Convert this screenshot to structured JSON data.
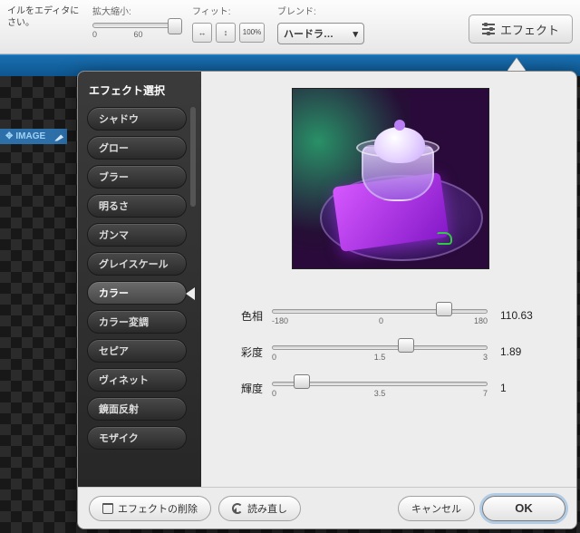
{
  "topbar": {
    "hint": "イルをエディタにさい。",
    "zoom_label": "拡大縮小:",
    "zoom_min": "0",
    "zoom_mid": "60",
    "fit_label": "フィット:",
    "pct_label": "100%",
    "blend_label": "ブレンド:",
    "blend_value": "ハードラ…",
    "effect_btn": "エフェクト"
  },
  "canvas": {
    "badge_text": "IMAGE"
  },
  "dialog": {
    "title": "エフェクト選択",
    "sidebar": [
      "シャドウ",
      "グロー",
      "ブラー",
      "明るさ",
      "ガンマ",
      "グレイスケール",
      "カラー",
      "カラー変調",
      "セピア",
      "ヴィネット",
      "鏡面反射",
      "モザイク"
    ],
    "selected_index": 6,
    "params": [
      {
        "label": "色相",
        "min": "-180",
        "mid": "0",
        "max": "180",
        "value": "110.63",
        "pos": 80
      },
      {
        "label": "彩度",
        "min": "0",
        "mid": "1.5",
        "max": "3",
        "value": "1.89",
        "pos": 62
      },
      {
        "label": "輝度",
        "min": "0",
        "mid": "3.5",
        "max": "7",
        "value": "1",
        "pos": 14
      }
    ],
    "footer": {
      "delete": "エフェクトの削除",
      "reset": "読み直し",
      "cancel": "キャンセル",
      "ok": "OK"
    }
  }
}
